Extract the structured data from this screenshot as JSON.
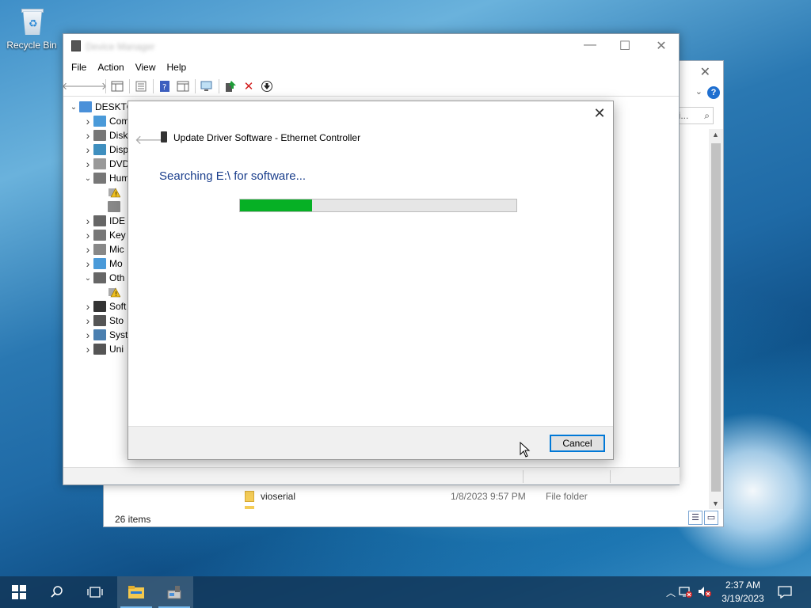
{
  "desktop": {
    "recycle_bin_label": "Recycle Bin"
  },
  "explorer": {
    "search_placeholder": "wi...",
    "row": {
      "name": "vioserial",
      "date": "1/8/2023 9:57 PM",
      "type": "File folder"
    },
    "status": "26 items"
  },
  "device_manager": {
    "menu": [
      "File",
      "Action",
      "View",
      "Help"
    ],
    "tree": [
      {
        "label": "DESKTOP",
        "level": 0,
        "state": "expanded",
        "icon": "computer-icon"
      },
      {
        "label": "Com",
        "level": 1,
        "state": "collapsed",
        "icon": "monitor-icon"
      },
      {
        "label": "Disk",
        "level": 1,
        "state": "collapsed",
        "icon": "disk-icon"
      },
      {
        "label": "Disp",
        "level": 1,
        "state": "collapsed",
        "icon": "display-icon"
      },
      {
        "label": "DVD",
        "level": 1,
        "state": "collapsed",
        "icon": "dvd-icon"
      },
      {
        "label": "Hum",
        "level": 1,
        "state": "expanded",
        "icon": "hid-icon"
      },
      {
        "label": "",
        "level": 2,
        "state": "none",
        "icon": "warning-device-icon"
      },
      {
        "label": "",
        "level": 2,
        "state": "none",
        "icon": "hid-device-icon"
      },
      {
        "label": "IDE",
        "level": 1,
        "state": "collapsed",
        "icon": "ide-icon"
      },
      {
        "label": "Key",
        "level": 1,
        "state": "collapsed",
        "icon": "keyboard-icon"
      },
      {
        "label": "Mic",
        "level": 1,
        "state": "collapsed",
        "icon": "mouse-icon"
      },
      {
        "label": "Mo",
        "level": 1,
        "state": "collapsed",
        "icon": "monitor-icon"
      },
      {
        "label": "Oth",
        "level": 1,
        "state": "expanded",
        "icon": "unknown-device-icon"
      },
      {
        "label": "",
        "level": 2,
        "state": "none",
        "icon": "warning-device-icon"
      },
      {
        "label": "Soft",
        "level": 1,
        "state": "collapsed",
        "icon": "software-icon"
      },
      {
        "label": "Sto",
        "level": 1,
        "state": "collapsed",
        "icon": "storage-icon"
      },
      {
        "label": "Syst",
        "level": 1,
        "state": "collapsed",
        "icon": "system-icon"
      },
      {
        "label": "Uni",
        "level": 1,
        "state": "collapsed",
        "icon": "usb-icon"
      }
    ]
  },
  "wizard": {
    "title": "Update Driver Software - Ethernet Controller",
    "searching_text": "Searching E:\\ for software...",
    "progress_fraction": 0.26,
    "cancel_label": "Cancel",
    "progress_color": "#06b025"
  },
  "taskbar": {
    "time": "2:37 AM",
    "date": "3/19/2023"
  }
}
